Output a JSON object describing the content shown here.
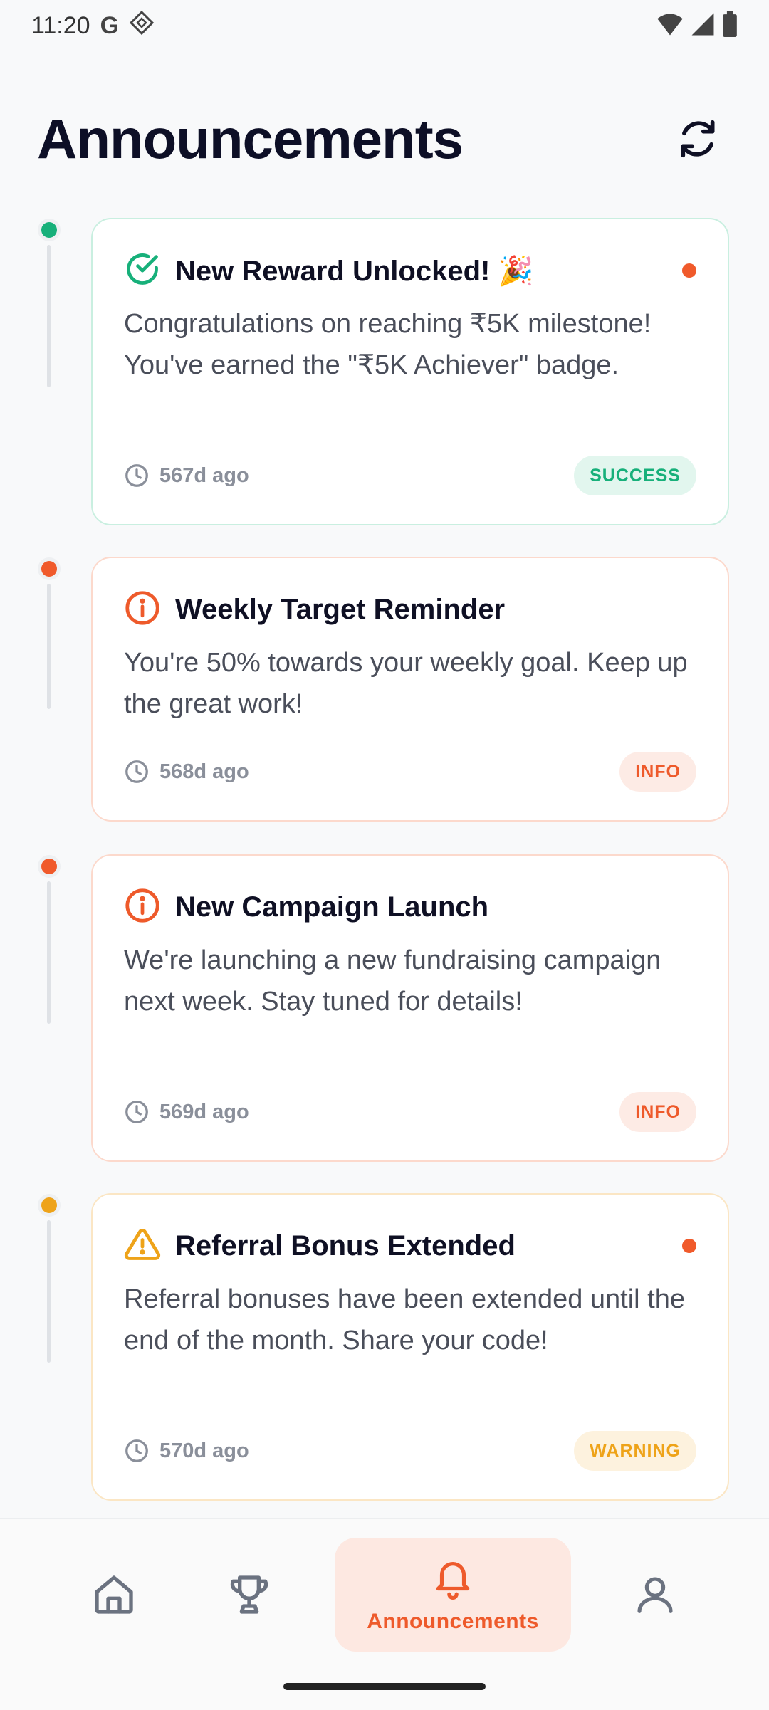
{
  "status_bar": {
    "time": "11:20",
    "google_letter": "G"
  },
  "header": {
    "title": "Announcements"
  },
  "announcements": [
    {
      "title": "New Reward Unlocked! 🎉",
      "body": "Congratulations on reaching ₹5K milestone! You've earned the \"₹5K Achiever\" badge.",
      "time": "567d ago",
      "badge": "SUCCESS",
      "type": "success",
      "unread": true,
      "icon": "check-circle-icon"
    },
    {
      "title": "Weekly Target Reminder",
      "body": "You're 50% towards your weekly goal. Keep up the great work!",
      "time": "568d ago",
      "badge": "INFO",
      "type": "info",
      "unread": false,
      "icon": "info-circle-icon"
    },
    {
      "title": "New Campaign Launch",
      "body": "We're launching a new fundraising campaign next week. Stay tuned for details!",
      "time": "569d ago",
      "badge": "INFO",
      "type": "info",
      "unread": false,
      "icon": "info-circle-icon"
    },
    {
      "title": "Referral Bonus Extended",
      "body": "Referral bonuses have been extended until the end of the month. Share your code!",
      "time": "570d ago",
      "badge": "WARNING",
      "type": "warning",
      "unread": true,
      "icon": "warning-triangle-icon"
    }
  ],
  "nav": {
    "items": [
      {
        "icon": "home-icon"
      },
      {
        "icon": "trophy-icon"
      },
      {
        "icon": "bell-icon",
        "label": "Announcements",
        "active": true
      },
      {
        "icon": "profile-icon"
      }
    ]
  },
  "colors": {
    "accent": "#ee5a2b",
    "success": "#17b07a",
    "warning": "#eea319",
    "text": "#0f1024"
  }
}
